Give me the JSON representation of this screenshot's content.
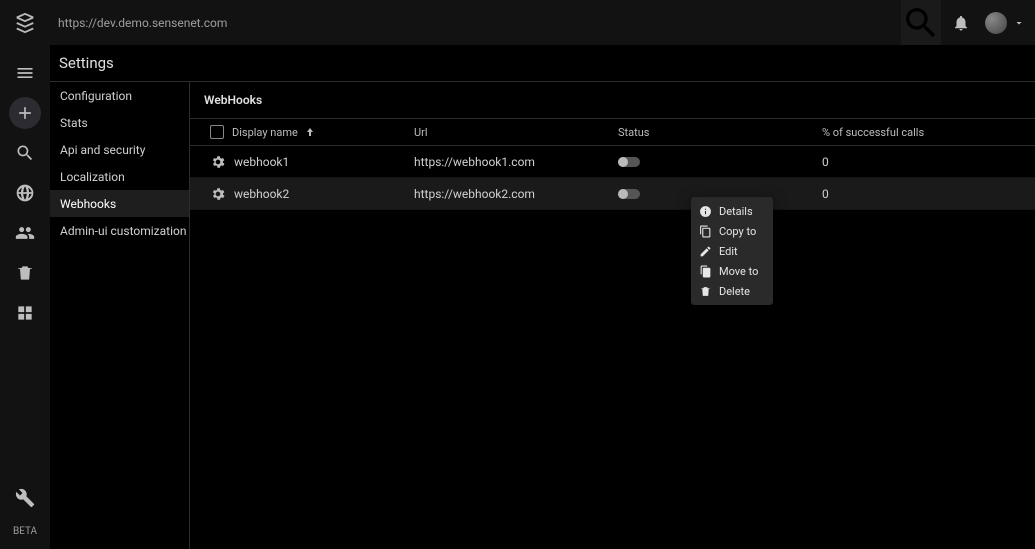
{
  "top": {
    "url": "https://dev.demo.sensenet.com"
  },
  "rail": {
    "beta": "BETA"
  },
  "page": {
    "title": "Settings"
  },
  "sidebar": {
    "items": [
      {
        "label": "Configuration"
      },
      {
        "label": "Stats"
      },
      {
        "label": "Api and security"
      },
      {
        "label": "Localization"
      },
      {
        "label": "Webhooks"
      },
      {
        "label": "Admin-ui customization"
      }
    ],
    "activeIndex": 4
  },
  "content": {
    "heading": "WebHooks",
    "columns": {
      "displayName": "Display name",
      "url": "Url",
      "status": "Status",
      "successPct": "% of successful calls"
    },
    "rows": [
      {
        "name": "webhook1",
        "url": "https://webhook1.com",
        "success": "0"
      },
      {
        "name": "webhook2",
        "url": "https://webhook2.com",
        "success": "0"
      }
    ]
  },
  "menu": {
    "items": [
      {
        "label": "Details"
      },
      {
        "label": "Copy to"
      },
      {
        "label": "Edit"
      },
      {
        "label": "Move to"
      },
      {
        "label": "Delete"
      }
    ]
  }
}
